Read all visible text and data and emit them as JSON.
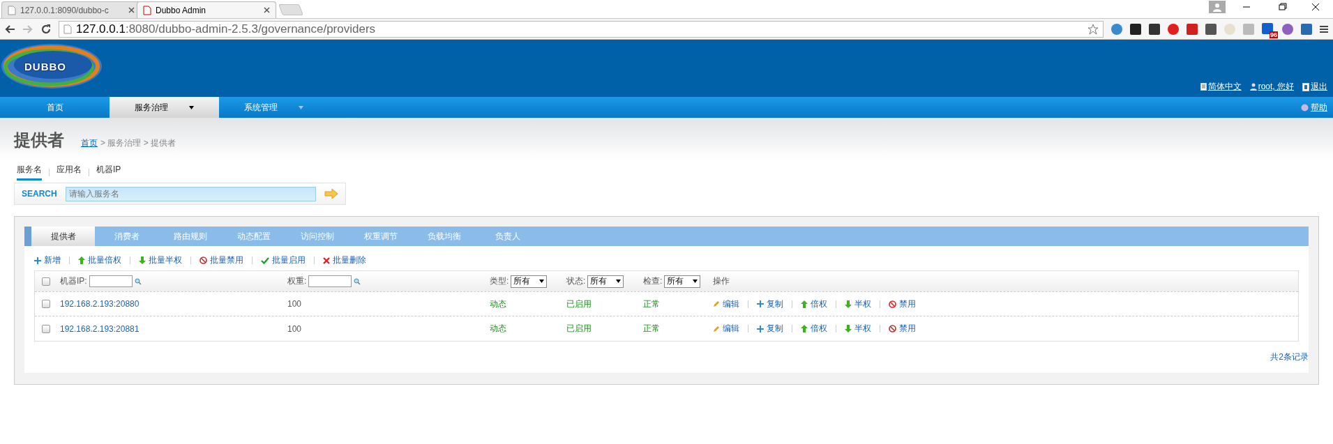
{
  "browser": {
    "tabs": [
      {
        "title": "127.0.0.1:8090/dubbo-c",
        "selected": false
      },
      {
        "title": "Dubbo Admin",
        "selected": true
      }
    ],
    "address": {
      "host": "127.0.0.1",
      "path": ":8080/dubbo-admin-2.5.3/governance/providers"
    },
    "extension_badge": "96"
  },
  "header": {
    "logo": "DUBBO",
    "links": [
      {
        "kind": "doc",
        "label": "简体中文"
      },
      {
        "kind": "user",
        "label": "root, 您好"
      },
      {
        "kind": "exit",
        "label": "退出"
      }
    ]
  },
  "nav": {
    "items": [
      {
        "label": "首页",
        "selected": false,
        "has_menu": false
      },
      {
        "label": "服务治理",
        "selected": true,
        "has_menu": true
      },
      {
        "label": "系统管理",
        "selected": false,
        "has_menu": true
      }
    ],
    "help": "帮助"
  },
  "page": {
    "title": "提供者",
    "breadcrumb": {
      "link": "首页",
      "rest": "> 服务治理 > 提供者"
    }
  },
  "search_tabs": [
    {
      "label": "服务名",
      "selected": true
    },
    {
      "label": "应用名",
      "selected": false
    },
    {
      "label": "机器IP",
      "selected": false
    }
  ],
  "search": {
    "label": "SEARCH",
    "placeholder": "请输入服务名"
  },
  "panel_tabs": [
    {
      "label": "提供者",
      "selected": true
    },
    {
      "label": "消费者",
      "selected": false
    },
    {
      "label": "路由规则",
      "selected": false
    },
    {
      "label": "动态配置",
      "selected": false
    },
    {
      "label": "访问控制",
      "selected": false
    },
    {
      "label": "权重调节",
      "selected": false
    },
    {
      "label": "负载均衡",
      "selected": false
    },
    {
      "label": "负责人",
      "selected": false
    }
  ],
  "toolbar": [
    {
      "kind": "plus",
      "label": "新增"
    },
    {
      "kind": "up",
      "label": "批量倍权"
    },
    {
      "kind": "down",
      "label": "批量半权"
    },
    {
      "kind": "ban",
      "label": "批量禁用"
    },
    {
      "kind": "check",
      "label": "批量启用"
    },
    {
      "kind": "cross",
      "label": "批量删除"
    }
  ],
  "table": {
    "header": {
      "checked": false,
      "ip_label": "机器IP:",
      "weight_label": "权重:",
      "filters": [
        {
          "label": "类型:",
          "value": "所有"
        },
        {
          "label": "状态:",
          "value": "所有"
        },
        {
          "label": "检查:",
          "value": "所有"
        }
      ],
      "actions_label": "操作"
    },
    "rows": [
      {
        "checked": false,
        "address": "192.168.2.193:20880",
        "weight": "100",
        "type": "动态",
        "status": "已启用",
        "check": "正常",
        "actions": [
          {
            "kind": "edit",
            "label": "编辑"
          },
          {
            "kind": "plus",
            "label": "复制"
          },
          {
            "kind": "up",
            "label": "倍权"
          },
          {
            "kind": "down",
            "label": "半权"
          },
          {
            "kind": "ban",
            "label": "禁用"
          }
        ]
      },
      {
        "checked": false,
        "address": "192.168.2.193:20881",
        "weight": "100",
        "type": "动态",
        "status": "已启用",
        "check": "正常",
        "actions": [
          {
            "kind": "edit",
            "label": "编辑"
          },
          {
            "kind": "plus",
            "label": "复制"
          },
          {
            "kind": "up",
            "label": "倍权"
          },
          {
            "kind": "down",
            "label": "半权"
          },
          {
            "kind": "ban",
            "label": "禁用"
          }
        ]
      }
    ],
    "total": "共2条记录"
  }
}
